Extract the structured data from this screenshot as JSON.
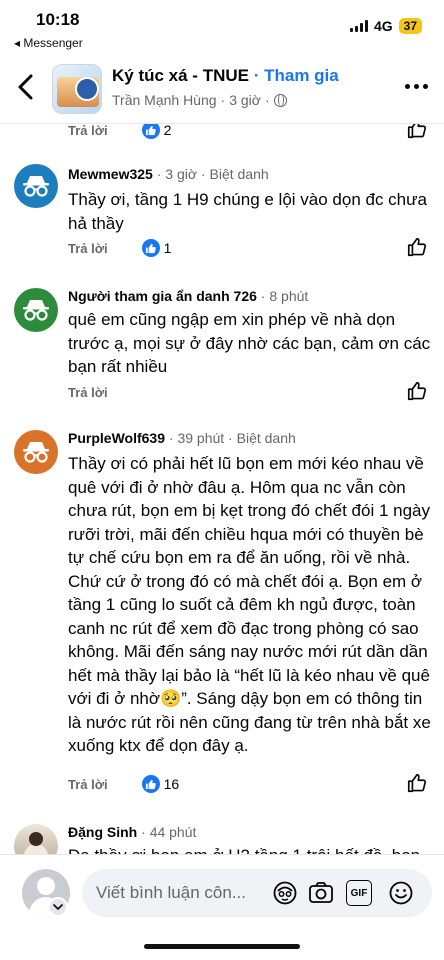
{
  "status_bar": {
    "time": "10:18",
    "back_app": "◂ Messenger",
    "network": "4G",
    "battery": "37"
  },
  "header": {
    "group_name": "Ký túc xá - TNUE",
    "join_separator": " · ",
    "join_label": "Tham gia",
    "author": "Trần Mạnh Hùng",
    "time": "3 giờ",
    "dot": "·"
  },
  "colors": {
    "accent": "#1877f2",
    "secondary_text": "#65676b",
    "anon_blue": "#1d7dbf",
    "anon_green": "#2e8b3d",
    "anon_orange": "#d9732a"
  },
  "comments": {
    "top_partial": {
      "reply": "Trả lời",
      "likes": "2"
    },
    "c1": {
      "name": "Mewmew325",
      "time": "3 giờ",
      "badge": "Biệt danh",
      "text": "Thầy ơi, tầng 1 H9 chúng e lội vào dọn đc chưa hả thầy",
      "reply": "Trả lời",
      "likes": "1",
      "avatar": "incognito-icon"
    },
    "c2": {
      "name": "Người tham gia ẩn danh 726",
      "time": "8 phút",
      "text": "quê em cũng ngập em xin phép về nhà dọn trước ạ, mọi sự ở đây nhờ các bạn, cảm ơn các bạn rất nhiều",
      "reply": "Trả lời",
      "avatar": "incognito-icon"
    },
    "c3": {
      "name": "PurpleWolf639",
      "time": "39 phút",
      "badge": "Biệt danh",
      "text": "Thầy ơi có phải hết lũ bọn em mới kéo nhau về quê với đi ở nhờ đâu ạ. Hôm qua nc vẫn còn chưa rút, bọn em bị kẹt trong đó chết đói 1 ngày rưỡi trời, mãi đến chiều hqua mới có thuyền bè tự chế cứu bọn em ra để ăn uống, rồi về nhà. Chứ cứ ở trong đó có mà chết đói ạ. Bọn em ở tầng 1 cũng lo suốt cả đêm kh ngủ được, toàn canh nc rút để xem đồ đạc trong phòng có sao không. Mãi đến sáng nay nước mới rút dần dần hết mà thầy lại bảo là “hết lũ là kéo nhau về quê với đi ở nhờ🥺”. Sáng dậy bọn em có thông tin là nước rút rồi nên cũng đang từ trên nhà bắt xe xuống ktx để dọn đây ạ.",
      "reply": "Trả lời",
      "likes": "16",
      "avatar": "incognito-icon"
    },
    "c4": {
      "name": "Đặng Sinh",
      "time": "44 phút",
      "text": "Dạ thầy ơi bọn em ở H2 tầng 1 trôi hết đồ, bọn",
      "avatar": "profile-photo"
    }
  },
  "composer": {
    "placeholder": "Viết bình luận côn...",
    "gif_label": "GIF"
  }
}
